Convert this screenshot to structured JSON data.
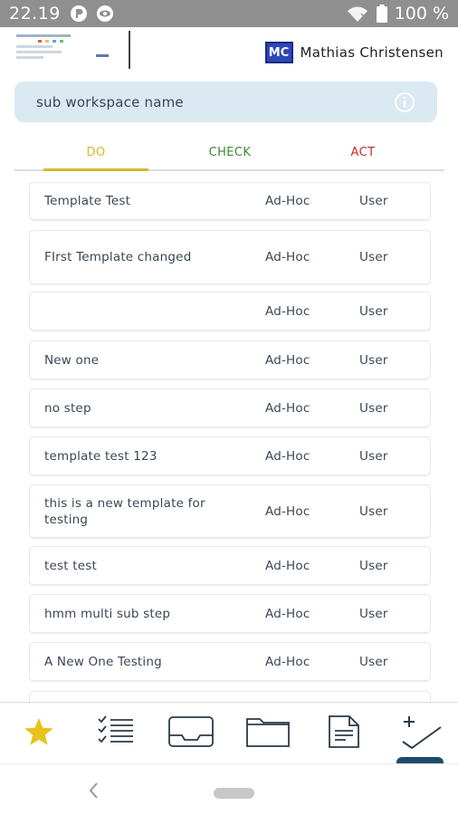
{
  "status_bar": {
    "time": "22.19",
    "battery": "100 %"
  },
  "header": {
    "avatar_initials": "MC",
    "user_name": "Mathias Christensen"
  },
  "workspace": {
    "value": "sub workspace name"
  },
  "tabs": [
    {
      "label": "DO",
      "color": "#d6b82a",
      "active": true
    },
    {
      "label": "CHECK",
      "color": "#3b8a2e",
      "active": false
    },
    {
      "label": "ACT",
      "color": "#c22a2a",
      "active": false
    }
  ],
  "templates": [
    {
      "name": "Template Test",
      "type": "Ad-Hoc",
      "owner": "User"
    },
    {
      "name": "FIrst Template changed",
      "type": "Ad-Hoc",
      "owner": "User"
    },
    {
      "name": "",
      "type": "Ad-Hoc",
      "owner": "User"
    },
    {
      "name": "New one",
      "type": "Ad-Hoc",
      "owner": "User"
    },
    {
      "name": "no step",
      "type": "Ad-Hoc",
      "owner": "User"
    },
    {
      "name": "template test 123",
      "type": "Ad-Hoc",
      "owner": "User"
    },
    {
      "name": "this is a new template for testing",
      "type": "Ad-Hoc",
      "owner": "User"
    },
    {
      "name": "test test",
      "type": "Ad-Hoc",
      "owner": "User"
    },
    {
      "name": "hmm multi sub step",
      "type": "Ad-Hoc",
      "owner": "User"
    },
    {
      "name": "A New One Testing",
      "type": "Ad-Hoc",
      "owner": "User"
    },
    {
      "name": "",
      "type": "",
      "owner": ""
    }
  ],
  "bottom_nav": [
    {
      "icon": "star-icon"
    },
    {
      "icon": "checklist-icon"
    },
    {
      "icon": "inbox-icon"
    },
    {
      "icon": "folder-icon"
    },
    {
      "icon": "document-icon"
    },
    {
      "icon": "add-task-icon",
      "active": true
    }
  ],
  "colors": {
    "accent": "#1f4b6a",
    "star": "#e8c21c",
    "workspace_bg": "#dbe9f2"
  }
}
